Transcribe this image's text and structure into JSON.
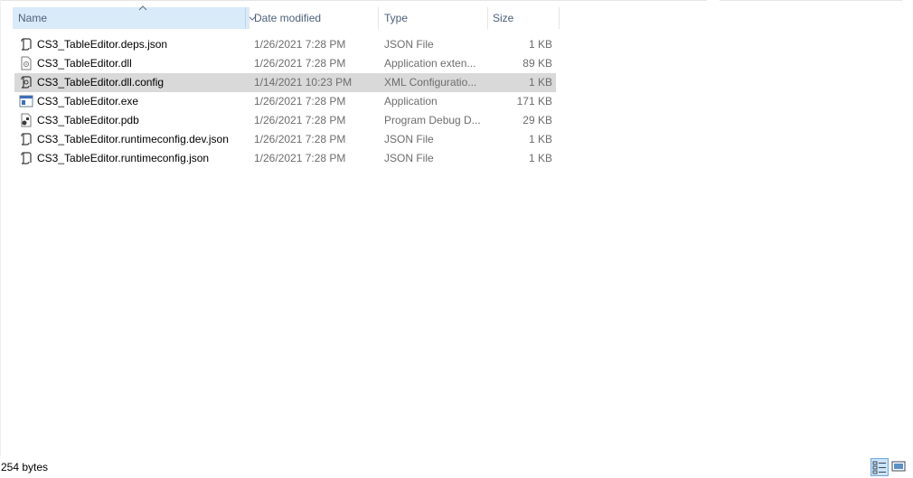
{
  "columns": {
    "name": "Name",
    "date_modified": "Date modified",
    "type": "Type",
    "size": "Size"
  },
  "files": [
    {
      "name": "CS3_TableEditor.deps.json",
      "date": "1/26/2021 7:28 PM",
      "type": "JSON File",
      "size": "1 KB",
      "icon": "json-file-icon",
      "selected": false
    },
    {
      "name": "CS3_TableEditor.dll",
      "date": "1/26/2021 7:28 PM",
      "type": "Application exten...",
      "size": "89 KB",
      "icon": "dll-file-icon",
      "selected": false
    },
    {
      "name": "CS3_TableEditor.dll.config",
      "date": "1/14/2021 10:23 PM",
      "type": "XML Configuratio...",
      "size": "1 KB",
      "icon": "config-file-icon",
      "selected": true
    },
    {
      "name": "CS3_TableEditor.exe",
      "date": "1/26/2021 7:28 PM",
      "type": "Application",
      "size": "171 KB",
      "icon": "exe-file-icon",
      "selected": false
    },
    {
      "name": "CS3_TableEditor.pdb",
      "date": "1/26/2021 7:28 PM",
      "type": "Program Debug D...",
      "size": "29 KB",
      "icon": "pdb-file-icon",
      "selected": false
    },
    {
      "name": "CS3_TableEditor.runtimeconfig.dev.json",
      "date": "1/26/2021 7:28 PM",
      "type": "JSON File",
      "size": "1 KB",
      "icon": "json-file-icon",
      "selected": false
    },
    {
      "name": "CS3_TableEditor.runtimeconfig.json",
      "date": "1/26/2021 7:28 PM",
      "type": "JSON File",
      "size": "1 KB",
      "icon": "json-file-icon",
      "selected": false
    }
  ],
  "status": {
    "selection_size": "254 bytes"
  },
  "colors": {
    "header_selected_bg": "#d9ebf9",
    "row_selected_bg": "#d9d9d9",
    "secondary_text": "#6d6d6d"
  }
}
